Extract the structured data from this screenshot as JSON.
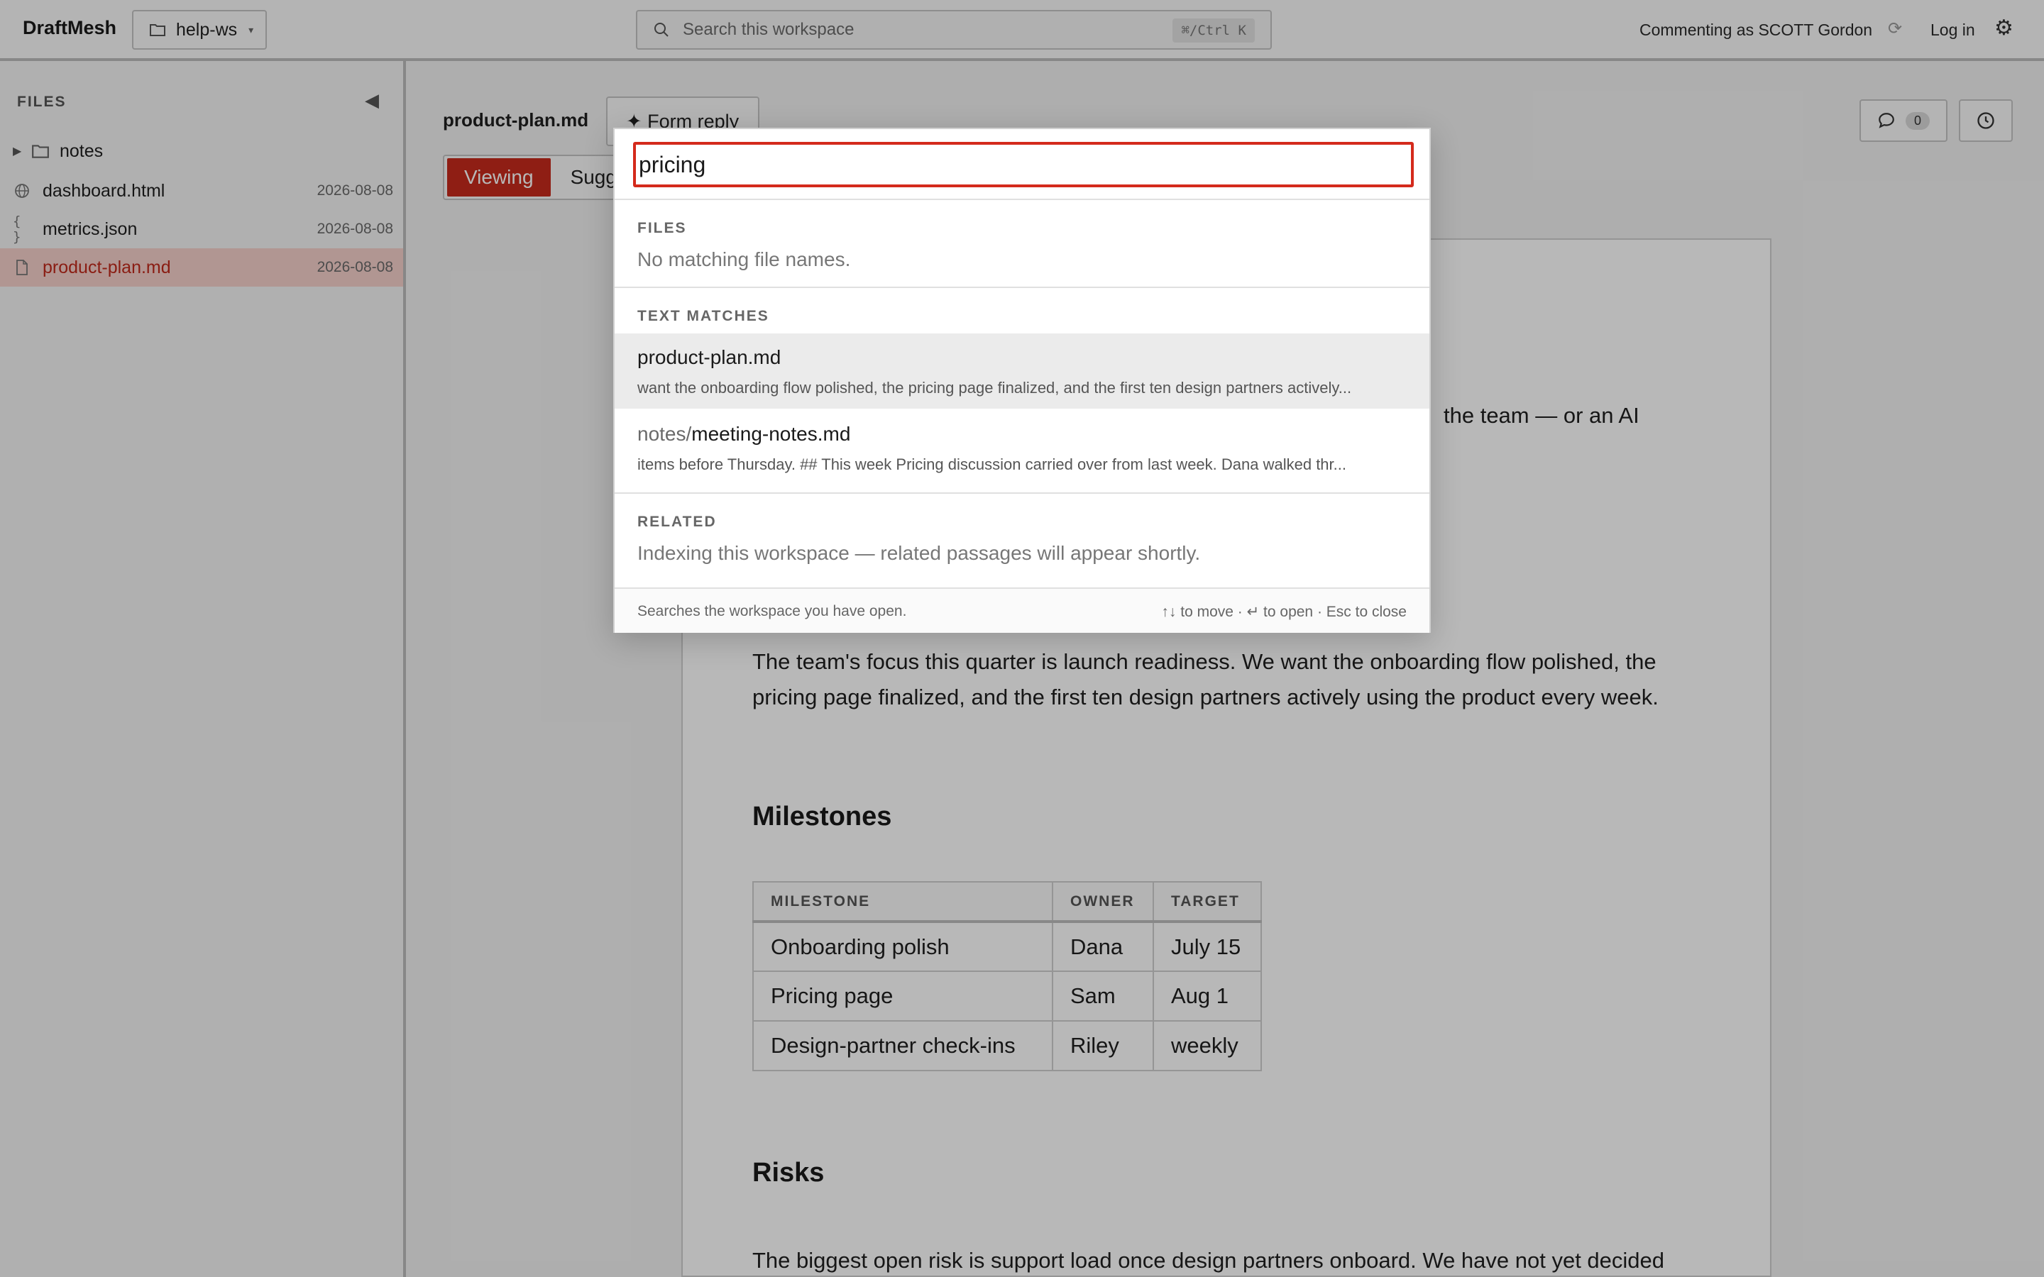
{
  "header": {
    "brand": "DraftMesh",
    "workspace": "help-ws",
    "search_placeholder": "Search this workspace",
    "search_shortcut": "⌘/Ctrl K",
    "commenting_as": "Commenting as SCOTT Gordon",
    "login": "Log in"
  },
  "sidebar": {
    "label": "FILES",
    "items": [
      {
        "name": "notes",
        "type": "folder",
        "date": ""
      },
      {
        "name": "dashboard.html",
        "type": "html",
        "date": "2026-08-08"
      },
      {
        "name": "metrics.json",
        "type": "json",
        "date": "2026-08-08"
      },
      {
        "name": "product-plan.md",
        "type": "md",
        "date": "2026-08-08",
        "active": true
      }
    ]
  },
  "document": {
    "filename": "product-plan.md",
    "form_reply": "✦ Form reply",
    "tabs": [
      "Viewing",
      "Sugg"
    ],
    "comment_count": "0",
    "peek_text": "the team — or an AI",
    "focus_line1": "The team's focus this quarter is launch readiness. We want the onboarding flow polished, the",
    "focus_line2": "pricing page finalized, and the first ten design partners actively using the product every week.",
    "milestones_heading": "Milestones",
    "table": {
      "headers": [
        "MILESTONE",
        "OWNER",
        "TARGET"
      ],
      "rows": [
        [
          "Onboarding polish",
          "Dana",
          "July 15"
        ],
        [
          "Pricing page",
          "Sam",
          "Aug 1"
        ],
        [
          "Design-partner check-ins",
          "Riley",
          "weekly"
        ]
      ]
    },
    "risks_heading": "Risks",
    "risks_line": "The biggest open risk is support load once design partners onboard. We have not yet decided"
  },
  "search_modal": {
    "query": "pricing",
    "files_label": "FILES",
    "files_empty": "No matching file names.",
    "text_label": "TEXT MATCHES",
    "results": [
      {
        "dir": "",
        "file": "product-plan.md",
        "snippet": "want the onboarding flow polished, the pricing page finalized, and the first ten design partners actively..."
      },
      {
        "dir": "notes/",
        "file": "meeting-notes.md",
        "snippet": "items before Thursday. ## This week Pricing discussion carried over from last week. Dana walked thr..."
      }
    ],
    "related_label": "RELATED",
    "related_text": "Indexing this workspace — related passages will appear shortly.",
    "footer_left": "Searches the workspace you have open.",
    "footer_right": "↑↓ to move · ↵ to open · Esc to close"
  },
  "colors": {
    "accent": "#c62a1c",
    "active_row": "#f6d0cb"
  }
}
